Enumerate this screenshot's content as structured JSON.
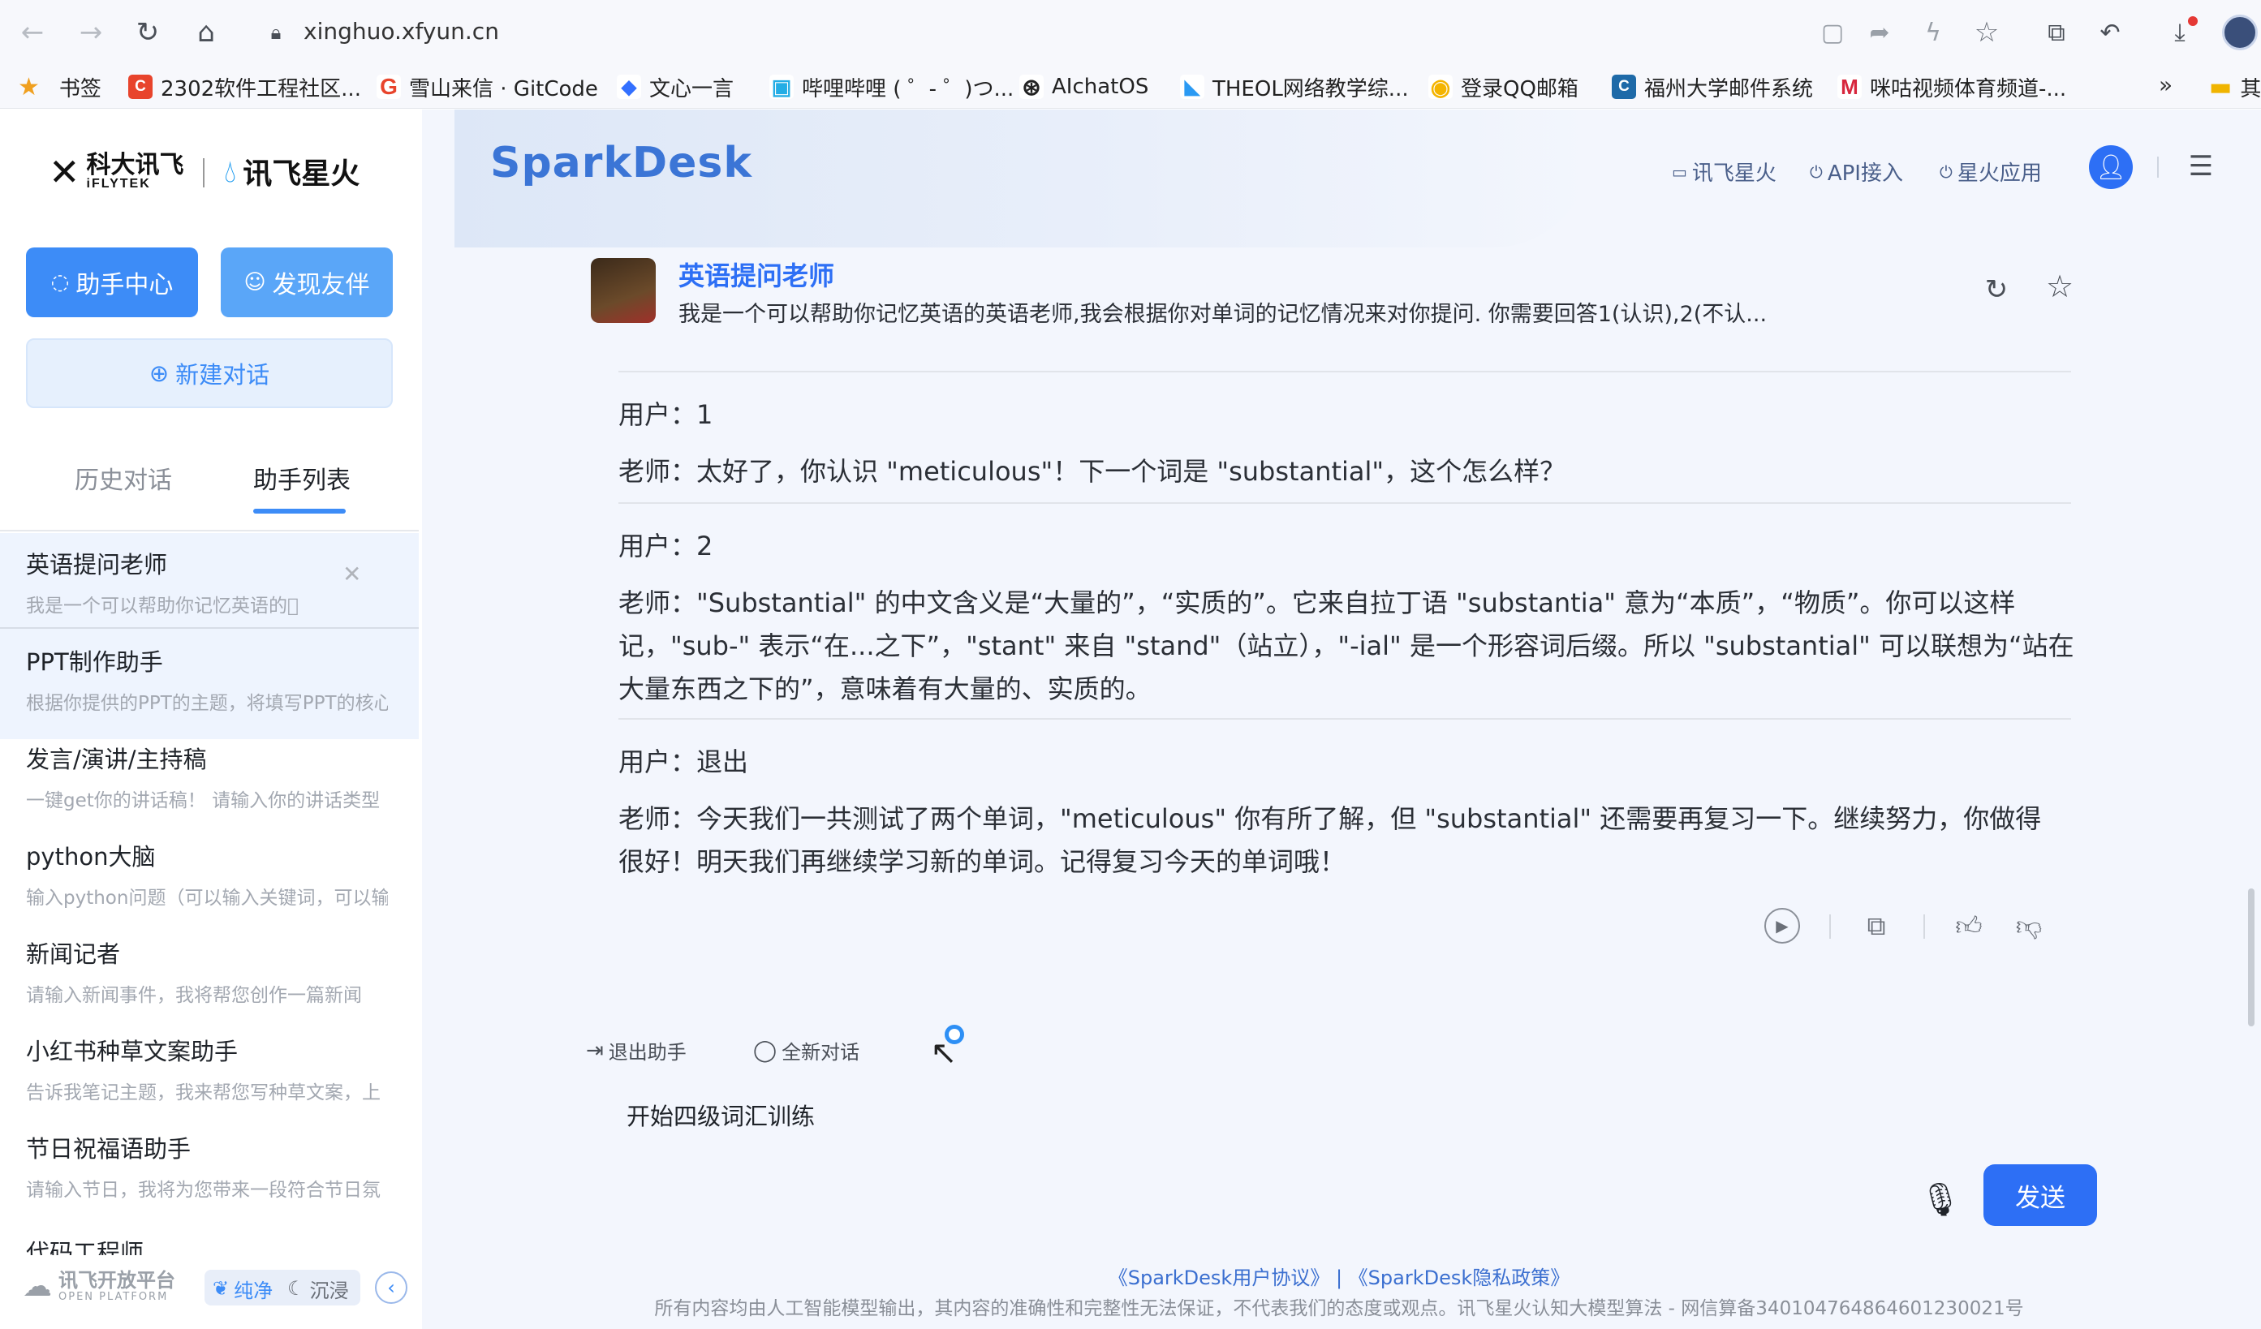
{
  "browser": {
    "url": "xinghuo.xfyun.cn",
    "bookmarks": [
      {
        "icon": "star-bookmark-icon",
        "label": "书签",
        "color": "#f0a020"
      },
      {
        "icon": "c-favicon",
        "label": "2302软件工程社区...",
        "color": "#e8442c",
        "glyph": "C"
      },
      {
        "icon": "g-favicon",
        "label": "雪山来信 · GitCode",
        "color": "#e8442c",
        "glyph": "G"
      },
      {
        "icon": "cube-favicon",
        "label": "文心一言",
        "color": "#3370ff",
        "glyph": "◆"
      },
      {
        "icon": "tv-favicon",
        "label": "哔哩哔哩 ( ゜- ゜)つ...",
        "color": "#23ade5",
        "glyph": "▣"
      },
      {
        "icon": "openai-favicon",
        "label": "AIchatOS",
        "color": "#222222",
        "glyph": "⊛"
      },
      {
        "icon": "theol-favicon",
        "label": "THEOL网络教学综...",
        "color": "#2b9af3",
        "glyph": "◣"
      },
      {
        "icon": "qq-favicon",
        "label": "登录QQ邮箱",
        "color": "#f4b400",
        "glyph": "◉"
      },
      {
        "icon": "c2-favicon",
        "label": "福州大学邮件系统",
        "color": "#1e6aa8",
        "glyph": "C"
      },
      {
        "icon": "m-favicon",
        "label": "咪咕视频体育频道-...",
        "color": "#d7263d",
        "glyph": "M"
      }
    ],
    "more": "»",
    "folder_label": "其"
  },
  "sidebar": {
    "logo_left": "科大讯飞",
    "logo_left_sub": "iFLYTEK",
    "logo_right": "讯飞星火",
    "assistant_center": "助手中心",
    "discover_partner": "发现友伴",
    "new_chat": "新建对话",
    "tab_history": "历史对话",
    "tab_assistants": "助手列表",
    "items": [
      {
        "title": "英语提问老师",
        "desc": "我是一个可以帮助你记忆英语的\u0000"
      },
      {
        "title": "PPT制作助手",
        "desc": "根据你提供的PPT的主题，将填写PPT的核心"
      },
      {
        "title": "发言/演讲/主持稿",
        "desc": "一键get你的讲话稿！ 请输入你的讲话类型"
      },
      {
        "title": "python大脑",
        "desc": "输入python问题（可以输入关键词，可以输"
      },
      {
        "title": "新闻记者",
        "desc": "请输入新闻事件，我将帮您创作一篇新闻"
      },
      {
        "title": "小红书种草文案助手",
        "desc": "告诉我笔记主题，我来帮您写种草文案，上"
      },
      {
        "title": "节日祝福语助手",
        "desc": "请输入节日，我将为您带来一段符合节日氛"
      },
      {
        "title": "代码工程师",
        "desc": ""
      }
    ],
    "platform": "讯飞开放平台",
    "platform_sub": "OPEN PLATFORM",
    "mode_clean": "纯净",
    "mode_immersive": "沉浸"
  },
  "header": {
    "brand": "SparkDesk",
    "links": [
      "讯飞星火",
      "API接入",
      "星火应用"
    ]
  },
  "assistant": {
    "name": "英语提问老师",
    "desc": "我是一个可以帮助你记忆英语的英语老师,我会根据你对单词的记忆情况来对你提问. 你需要回答1(认识),2(不认..."
  },
  "chat": [
    {
      "user": "用户：1",
      "teacher": [
        "老师：太好了，你认识 \"meticulous\"！下一个词是 \"substantial\"，这个怎么样？"
      ]
    },
    {
      "user": "用户：2",
      "teacher": [
        "老师：\"Substantial\" 的中文含义是“大量的”，“实质的”。它来自拉丁语 \"substantia\" 意为“本质”，“物质”。你可以这样",
        "记，\"sub-\" 表示“在...之下”，\"stant\" 来自 \"stand\"（站立），\"-ial\" 是一个形容词后缀。所以 \"substantial\" 可以联想为“站在",
        "大量东西之下的”，意味着有大量的、实质的。"
      ]
    },
    {
      "user": "用户：退出",
      "teacher": [
        "老师：今天我们一共测试了两个单词，\"meticulous\" 你有所了解，但 \"substantial\" 还需要再复习一下。继续努力，你做得",
        "很好！明天我们再继续学习新的单词。记得复习今天的单词哦！"
      ]
    }
  ],
  "actions": {
    "exit_assistant": "退出助手",
    "new_conversation": "全新对话"
  },
  "input": {
    "value": "开始四级词汇训练",
    "send": "发送"
  },
  "footer": {
    "links": "《SparkDesk用户协议》 | 《SparkDesk隐私政策》",
    "disclaimer": "所有内容均由人工智能模型输出，其内容的准确性和完整性无法保证，不代表我们的态度或观点。讯飞星火认知大模型算法 - 网信算备340104764864601230021号"
  },
  "colors": {
    "accent": "#3d8cf7",
    "send": "#2d6ff5",
    "brand": "#3b75d6"
  }
}
